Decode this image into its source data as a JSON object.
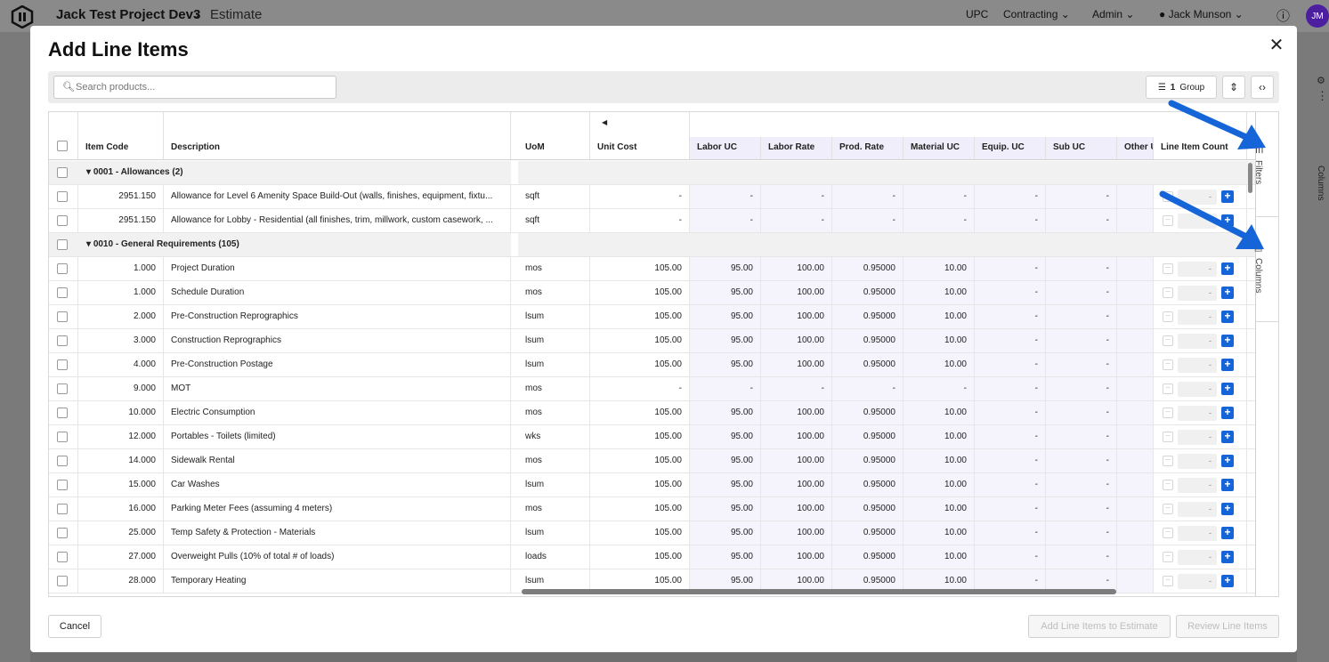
{
  "topbar": {
    "project": "Jack Test Project Dev3",
    "page": "Estimate",
    "nav": [
      "UPC",
      "Contracting",
      "Admin"
    ],
    "user_name": "Jack Munson",
    "avatar_initials": "JM"
  },
  "modal": {
    "title": "Add Line Items",
    "search_placeholder": "Search products...",
    "group_count": "1",
    "group_label": "Group",
    "cancel_label": "Cancel",
    "add_label": "Add Line Items to Estimate",
    "review_label": "Review Line Items"
  },
  "columns": {
    "item_code": "Item Code",
    "description": "Description",
    "uom": "UoM",
    "unit_cost": "Unit Cost",
    "labor_uc": "Labor UC",
    "labor_rate": "Labor Rate",
    "prod_rate": "Prod. Rate",
    "material_uc": "Material UC",
    "equip_uc": "Equip. UC",
    "sub_uc": "Sub UC",
    "other_uc": "Other UC",
    "line_item_count": "Line Item Count"
  },
  "sidebar": {
    "filters": "Filters",
    "columns": "Columns"
  },
  "background": {
    "columns_tab": "Columns"
  },
  "rows": [
    {
      "type": "group",
      "label": "0001 - Allowances (2)"
    },
    {
      "type": "item",
      "code": "2951.150",
      "desc": "Allowance for Level 6 Amenity Space Build-Out (walls, finishes, equipment, fixtu...",
      "uom": "sqft",
      "unit_cost": "-",
      "labor_uc": "-",
      "labor_rate": "-",
      "prod_rate": "-",
      "material_uc": "-",
      "equip_uc": "-",
      "sub_uc": "-",
      "count": "-"
    },
    {
      "type": "item",
      "code": "2951.150",
      "desc": "Allowance for Lobby - Residential (all finishes, trim, millwork, custom casework, ...",
      "uom": "sqft",
      "unit_cost": "-",
      "labor_uc": "-",
      "labor_rate": "-",
      "prod_rate": "-",
      "material_uc": "-",
      "equip_uc": "-",
      "sub_uc": "-",
      "count": "-"
    },
    {
      "type": "group",
      "label": "0010 - General Requirements (105)"
    },
    {
      "type": "item",
      "code": "1.000",
      "desc": "Project Duration",
      "uom": "mos",
      "unit_cost": "105.00",
      "labor_uc": "95.00",
      "labor_rate": "100.00",
      "prod_rate": "0.95000",
      "material_uc": "10.00",
      "equip_uc": "-",
      "sub_uc": "-",
      "count": "-"
    },
    {
      "type": "item",
      "code": "1.000",
      "desc": "Schedule Duration",
      "uom": "mos",
      "unit_cost": "105.00",
      "labor_uc": "95.00",
      "labor_rate": "100.00",
      "prod_rate": "0.95000",
      "material_uc": "10.00",
      "equip_uc": "-",
      "sub_uc": "-",
      "count": "-"
    },
    {
      "type": "item",
      "code": "2.000",
      "desc": "Pre-Construction Reprographics",
      "uom": "lsum",
      "unit_cost": "105.00",
      "labor_uc": "95.00",
      "labor_rate": "100.00",
      "prod_rate": "0.95000",
      "material_uc": "10.00",
      "equip_uc": "-",
      "sub_uc": "-",
      "count": "-"
    },
    {
      "type": "item",
      "code": "3.000",
      "desc": "Construction Reprographics",
      "uom": "lsum",
      "unit_cost": "105.00",
      "labor_uc": "95.00",
      "labor_rate": "100.00",
      "prod_rate": "0.95000",
      "material_uc": "10.00",
      "equip_uc": "-",
      "sub_uc": "-",
      "count": "-"
    },
    {
      "type": "item",
      "code": "4.000",
      "desc": "Pre-Construction Postage",
      "uom": "lsum",
      "unit_cost": "105.00",
      "labor_uc": "95.00",
      "labor_rate": "100.00",
      "prod_rate": "0.95000",
      "material_uc": "10.00",
      "equip_uc": "-",
      "sub_uc": "-",
      "count": "-"
    },
    {
      "type": "item",
      "code": "9.000",
      "desc": "MOT",
      "uom": "mos",
      "unit_cost": "-",
      "labor_uc": "-",
      "labor_rate": "-",
      "prod_rate": "-",
      "material_uc": "-",
      "equip_uc": "-",
      "sub_uc": "-",
      "count": "-"
    },
    {
      "type": "item",
      "code": "10.000",
      "desc": "Electric Consumption",
      "uom": "mos",
      "unit_cost": "105.00",
      "labor_uc": "95.00",
      "labor_rate": "100.00",
      "prod_rate": "0.95000",
      "material_uc": "10.00",
      "equip_uc": "-",
      "sub_uc": "-",
      "count": "-"
    },
    {
      "type": "item",
      "code": "12.000",
      "desc": "Portables - Toilets (limited)",
      "uom": "wks",
      "unit_cost": "105.00",
      "labor_uc": "95.00",
      "labor_rate": "100.00",
      "prod_rate": "0.95000",
      "material_uc": "10.00",
      "equip_uc": "-",
      "sub_uc": "-",
      "count": "-"
    },
    {
      "type": "item",
      "code": "14.000",
      "desc": "Sidewalk Rental",
      "uom": "mos",
      "unit_cost": "105.00",
      "labor_uc": "95.00",
      "labor_rate": "100.00",
      "prod_rate": "0.95000",
      "material_uc": "10.00",
      "equip_uc": "-",
      "sub_uc": "-",
      "count": "-"
    },
    {
      "type": "item",
      "code": "15.000",
      "desc": "Car Washes",
      "uom": "lsum",
      "unit_cost": "105.00",
      "labor_uc": "95.00",
      "labor_rate": "100.00",
      "prod_rate": "0.95000",
      "material_uc": "10.00",
      "equip_uc": "-",
      "sub_uc": "-",
      "count": "-"
    },
    {
      "type": "item",
      "code": "16.000",
      "desc": "Parking Meter Fees (assuming 4 meters)",
      "uom": "mos",
      "unit_cost": "105.00",
      "labor_uc": "95.00",
      "labor_rate": "100.00",
      "prod_rate": "0.95000",
      "material_uc": "10.00",
      "equip_uc": "-",
      "sub_uc": "-",
      "count": "-"
    },
    {
      "type": "item",
      "code": "25.000",
      "desc": "Temp Safety & Protection - Materials",
      "uom": "lsum",
      "unit_cost": "105.00",
      "labor_uc": "95.00",
      "labor_rate": "100.00",
      "prod_rate": "0.95000",
      "material_uc": "10.00",
      "equip_uc": "-",
      "sub_uc": "-",
      "count": "-"
    },
    {
      "type": "item",
      "code": "27.000",
      "desc": "Overweight Pulls (10% of total # of loads)",
      "uom": "loads",
      "unit_cost": "105.00",
      "labor_uc": "95.00",
      "labor_rate": "100.00",
      "prod_rate": "0.95000",
      "material_uc": "10.00",
      "equip_uc": "-",
      "sub_uc": "-",
      "count": "-"
    },
    {
      "type": "item",
      "code": "28.000",
      "desc": "Temporary Heating",
      "uom": "lsum",
      "unit_cost": "105.00",
      "labor_uc": "95.00",
      "labor_rate": "100.00",
      "prod_rate": "0.95000",
      "material_uc": "10.00",
      "equip_uc": "-",
      "sub_uc": "-",
      "count": "-"
    }
  ],
  "colors": {
    "accent": "#1565d8",
    "avatar": "#4b1fa0",
    "arrow": "#1565d8"
  }
}
